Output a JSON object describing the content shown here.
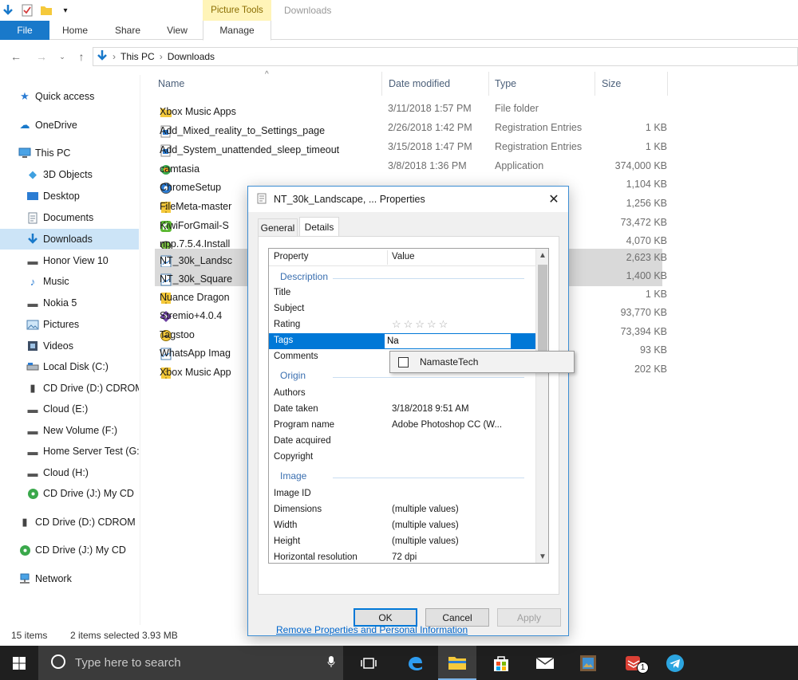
{
  "ribbon": {
    "context_group": "Picture Tools",
    "window_title": "Downloads",
    "tabs": {
      "file": "File",
      "home": "Home",
      "share": "Share",
      "view": "View",
      "manage": "Manage"
    }
  },
  "address": {
    "root": "This PC",
    "folder": "Downloads"
  },
  "sidebar": {
    "items": [
      {
        "label": "Quick access",
        "icon": "star-icon"
      },
      {
        "label": "OneDrive",
        "icon": "cloud-icon"
      },
      {
        "label": "This PC",
        "icon": "computer-icon"
      },
      {
        "label": "3D Objects",
        "icon": "cube-icon"
      },
      {
        "label": "Desktop",
        "icon": "desktop-icon"
      },
      {
        "label": "Documents",
        "icon": "document-icon"
      },
      {
        "label": "Downloads",
        "icon": "download-arrow-icon",
        "selected": true
      },
      {
        "label": "Honor View 10",
        "icon": "phone-icon"
      },
      {
        "label": "Music",
        "icon": "music-note-icon"
      },
      {
        "label": "Nokia 5",
        "icon": "phone-icon"
      },
      {
        "label": "Pictures",
        "icon": "pictures-icon"
      },
      {
        "label": "Videos",
        "icon": "film-icon"
      },
      {
        "label": "Local Disk (C:)",
        "icon": "drive-icon"
      },
      {
        "label": "CD Drive (D:) CDROM",
        "icon": "cd-drive-icon"
      },
      {
        "label": "Cloud (E:)",
        "icon": "drive-icon"
      },
      {
        "label": "New Volume (F:)",
        "icon": "drive-icon"
      },
      {
        "label": "Home Server Test (G:)",
        "icon": "drive-icon"
      },
      {
        "label": "Cloud (H:)",
        "icon": "drive-icon"
      },
      {
        "label": "CD Drive (J:) My CD",
        "icon": "green-disc-icon"
      },
      {
        "label": "CD Drive (D:) CDROM",
        "icon": "cd-drive-icon"
      },
      {
        "label": "CD Drive (J:) My CD",
        "icon": "green-disc-icon"
      },
      {
        "label": "Network",
        "icon": "network-icon"
      }
    ]
  },
  "columns": {
    "name": "Name",
    "date": "Date modified",
    "type": "Type",
    "size": "Size"
  },
  "files": [
    {
      "name": "Xbox Music Apps",
      "date": "3/11/2018 1:57 PM",
      "type": "File folder",
      "size": "",
      "icon": "folder-icon"
    },
    {
      "name": "Add_Mixed_reality_to_Settings_page",
      "date": "2/26/2018 1:42 PM",
      "type": "Registration Entries",
      "size": "1 KB",
      "icon": "registry-icon"
    },
    {
      "name": "Add_System_unattended_sleep_timeout",
      "date": "3/15/2018 1:47 PM",
      "type": "Registration Entries",
      "size": "1 KB",
      "icon": "registry-icon"
    },
    {
      "name": "camtasia",
      "date": "3/8/2018 1:36 PM",
      "type": "Application",
      "size": "374,000 KB",
      "icon": "app-icon"
    },
    {
      "name": "ChromeSetup",
      "date": "",
      "type": "",
      "size": "1,104 KB",
      "icon": "chrome-icon"
    },
    {
      "name": "FileMeta-master",
      "date": "",
      "type": "",
      "size": "1,256 KB",
      "icon": "zip-icon"
    },
    {
      "name": "KiwiForGmail-S",
      "date": "",
      "type": "",
      "size": "73,472 KB",
      "icon": "kiwi-icon"
    },
    {
      "name": "npp.7.5.4.Install",
      "date": "",
      "type": "",
      "size": "4,070 KB",
      "icon": "npp-icon"
    },
    {
      "name": "NT_30k_Landsc",
      "date": "",
      "type": "",
      "size": "2,623 KB",
      "icon": "image-icon",
      "selected": true
    },
    {
      "name": "NT_30k_Square",
      "date": "",
      "type": "",
      "size": "1,400 KB",
      "icon": "image-icon",
      "selected": true
    },
    {
      "name": "Nuance Dragon",
      "date": "",
      "type": "",
      "size": "1 KB",
      "icon": "zip-icon"
    },
    {
      "name": "Stremio+4.0.4",
      "date": "",
      "type": "",
      "size": "93,770 KB",
      "icon": "stremio-icon"
    },
    {
      "name": "Tagstoo",
      "date": "",
      "type": "",
      "size": "73,394 KB",
      "icon": "tagstoo-icon"
    },
    {
      "name": "WhatsApp Imag",
      "date": "",
      "type": "",
      "size": "93 KB",
      "icon": "image-icon"
    },
    {
      "name": "Xbox Music App",
      "date": "",
      "type": "",
      "size": "202 KB",
      "icon": "zip-icon"
    }
  ],
  "status": {
    "count": "15 items",
    "selection": "2 items selected 3.93 MB"
  },
  "taskbar": {
    "search_placeholder": "Type here to search",
    "badge": "1"
  },
  "dialog": {
    "title": "NT_30k_Landscape, ... Properties",
    "tabs": {
      "general": "General",
      "details": "Details"
    },
    "grid_headers": {
      "property": "Property",
      "value": "Value"
    },
    "sections": {
      "description": "Description",
      "origin": "Origin",
      "image": "Image"
    },
    "description_rows": [
      {
        "name": "Title",
        "value": ""
      },
      {
        "name": "Subject",
        "value": ""
      },
      {
        "name": "Rating",
        "value": "☆☆☆☆☆"
      },
      {
        "name": "Tags",
        "value": "Na"
      },
      {
        "name": "Comments",
        "value": ""
      }
    ],
    "origin_rows": [
      {
        "name": "Authors",
        "value": ""
      },
      {
        "name": "Date taken",
        "value": "3/18/2018 9:51 AM"
      },
      {
        "name": "Program name",
        "value": "Adobe Photoshop CC (W..."
      },
      {
        "name": "Date acquired",
        "value": ""
      },
      {
        "name": "Copyright",
        "value": ""
      }
    ],
    "image_rows": [
      {
        "name": "Image ID",
        "value": ""
      },
      {
        "name": "Dimensions",
        "value": "(multiple values)"
      },
      {
        "name": "Width",
        "value": "(multiple values)"
      },
      {
        "name": "Height",
        "value": "(multiple values)"
      },
      {
        "name": "Horizontal resolution",
        "value": "72 dpi"
      }
    ],
    "suggestion": "NamasteTech",
    "remove_link": "Remove Properties and Personal Information",
    "buttons": {
      "ok": "OK",
      "cancel": "Cancel",
      "apply": "Apply"
    }
  },
  "colors": {
    "accent": "#0078d7",
    "file_tab": "#1979ca",
    "context_tab": "#fff4b8",
    "selection": "#cce4f7"
  }
}
